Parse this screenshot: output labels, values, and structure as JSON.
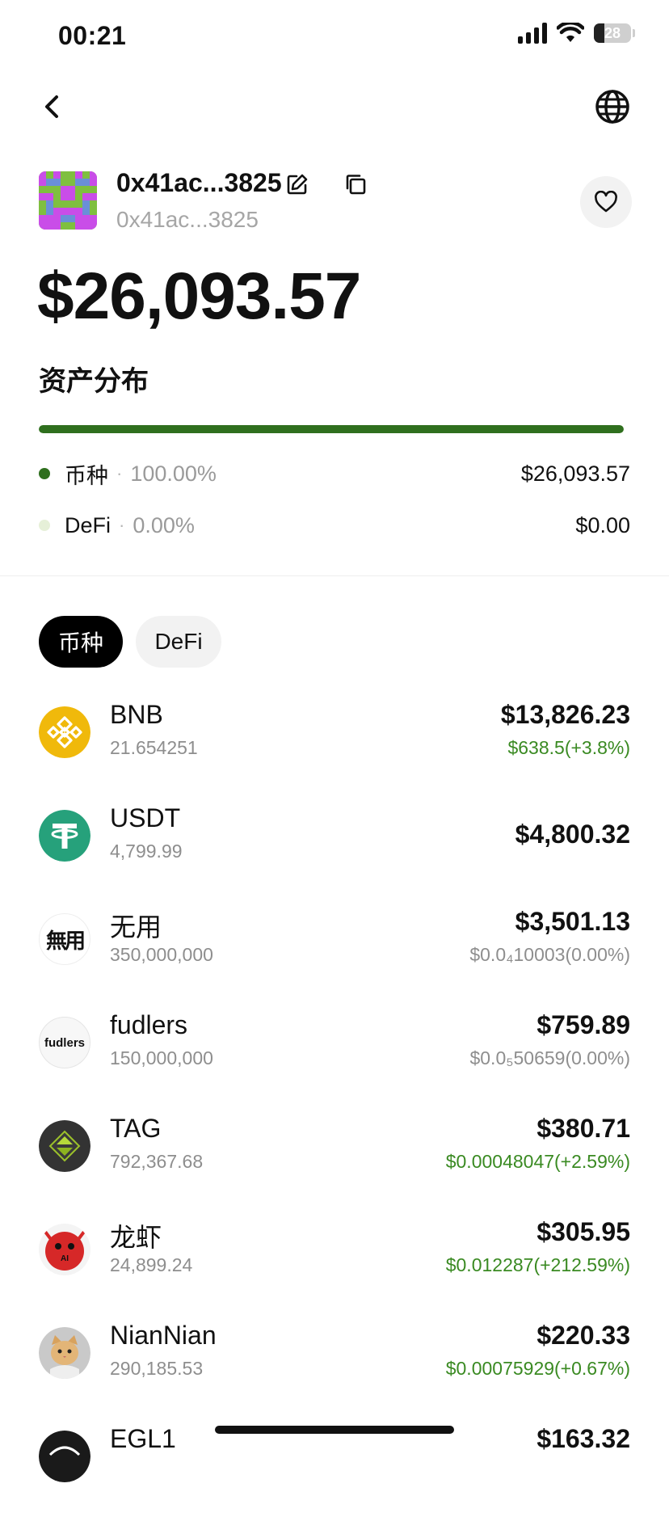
{
  "status_bar": {
    "time": "00:21",
    "battery": "28",
    "battery_level": 0.28
  },
  "nav": {
    "back_icon": "chevron-left-icon",
    "globe_icon": "globe-icon"
  },
  "wallet": {
    "name": "0x41ac...3825",
    "address": "0x41ac...3825",
    "total_balance": "$26,093.57"
  },
  "distribution": {
    "title": "资产分布",
    "bar_fill_fraction": 1.0,
    "items": [
      {
        "name": "币种",
        "sep": "·",
        "pct": "100.00%",
        "value": "$26,093.57",
        "color": "#2f6f1e"
      },
      {
        "name": "DeFi",
        "sep": "·",
        "pct": "0.00%",
        "value": "$0.00",
        "color": "#e6f0d8"
      }
    ]
  },
  "tabs": [
    {
      "label": "币种",
      "active": true
    },
    {
      "label": "DeFi",
      "active": false
    }
  ],
  "tokens": [
    {
      "name": "BNB",
      "amount": "21.654251",
      "value": "$13,826.23",
      "price": "$638.5(+3.8%)",
      "price_color": "green",
      "icon": "bnb-icon"
    },
    {
      "name": "USDT",
      "amount": "4,799.99",
      "value": "$4,800.32",
      "price": "",
      "price_color": "gray",
      "icon": "usdt-icon"
    },
    {
      "name": "无用",
      "amount": "350,000,000",
      "value": "$3,501.13",
      "price": "$0.0₄10003(0.00%)",
      "price_color": "gray",
      "icon": "wuyong-icon",
      "icon_text": "無用"
    },
    {
      "name": "fudlers",
      "amount": "150,000,000",
      "value": "$759.89",
      "price": "$0.0₅50659(0.00%)",
      "price_color": "gray",
      "icon": "fudlers-icon",
      "icon_text": "fudlers"
    },
    {
      "name": "TAG",
      "amount": "792,367.68",
      "value": "$380.71",
      "price": "$0.00048047(+2.59%)",
      "price_color": "green",
      "icon": "tag-icon"
    },
    {
      "name": "龙虾",
      "amount": "24,899.24",
      "value": "$305.95",
      "price": "$0.012287(+212.59%)",
      "price_color": "green",
      "icon": "lobster-icon",
      "icon_text": "AI"
    },
    {
      "name": "NianNian",
      "amount": "290,185.53",
      "value": "$220.33",
      "price": "$0.00075929(+0.67%)",
      "price_color": "green",
      "icon": "niannian-cat-icon"
    },
    {
      "name": "EGL1",
      "amount": "",
      "value": "$163.32",
      "price": "",
      "price_color": "gray",
      "icon": "egl1-icon"
    }
  ]
}
